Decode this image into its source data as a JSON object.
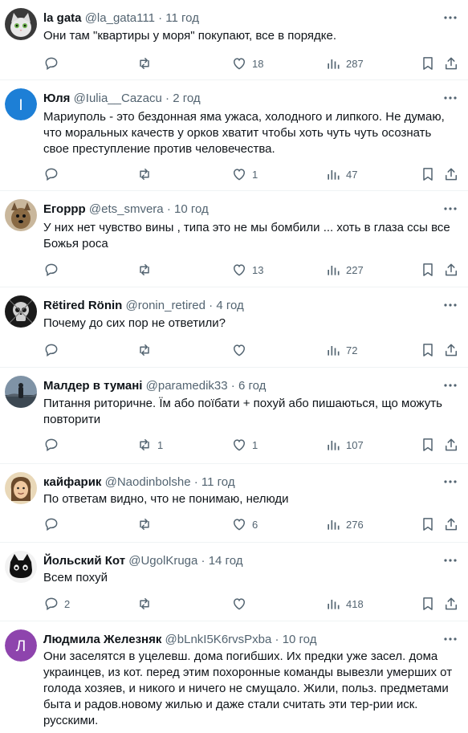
{
  "tweets": [
    {
      "name": "la gata",
      "handle": "@la_gata111",
      "time": "11 год",
      "text": "Они там \"квартиры у моря\" покупают, все в порядке.",
      "replies": "",
      "retweets": "",
      "likes": "18",
      "views": "287",
      "avatar": {
        "type": "cat",
        "bg": "#3a3a3a"
      }
    },
    {
      "name": "Юля",
      "handle": "@Iulia__Cazacu",
      "time": "2 год",
      "text": "Мариуполь - это бездонная яма ужаса, холодного и липкого. Не думаю, что моральных качеств у орков хватит чтобы хоть чуть чуть осознать свое преступление против человечества.",
      "replies": "",
      "retweets": "",
      "likes": "1",
      "views": "47",
      "avatar": {
        "type": "letter",
        "letter": "I",
        "bg": "#1d7fd6"
      }
    },
    {
      "name": "Егорpp",
      "handle": "@ets_smvera",
      "time": "10 год",
      "text": "У них нет чувство вины , типа это не мы бомбили ... хоть в глаза ссы все Божья роса",
      "replies": "",
      "retweets": "",
      "likes": "13",
      "views": "227",
      "avatar": {
        "type": "dog",
        "bg": "#c9b79c"
      }
    },
    {
      "name": "Rëtired Rönin",
      "handle": "@ronin_retired",
      "time": "4 год",
      "text": "Почему до сих пор не ответили?",
      "replies": "",
      "retweets": "",
      "likes": "",
      "views": "72",
      "avatar": {
        "type": "skull",
        "bg": "#1a1a1a"
      }
    },
    {
      "name": "Малдер в тумані",
      "handle": "@paramedik33",
      "time": "6 год",
      "text": "Питання риторичне. Їм або поїбати + похуй або пишаються, що можуть повторити",
      "replies": "",
      "retweets": "1",
      "likes": "1",
      "views": "107",
      "avatar": {
        "type": "landscape",
        "bg": "#5a6b7a"
      }
    },
    {
      "name": "кайфарик",
      "handle": "@Naodinbolshe",
      "time": "11 год",
      "text": "По ответам видно, что не понимаю, нелюди",
      "replies": "",
      "retweets": "",
      "likes": "6",
      "views": "276",
      "avatar": {
        "type": "face",
        "bg": "#e9d8b8"
      }
    },
    {
      "name": "Йольский Кот",
      "handle": "@UgolKruga",
      "time": "14 год",
      "text": "Всем похуй",
      "replies": "2",
      "retweets": "",
      "likes": "",
      "views": "418",
      "avatar": {
        "type": "blackcat",
        "bg": "#f2f2f2"
      }
    },
    {
      "name": "Людмила Железняк",
      "handle": "@bLnkI5K6rvsPxba",
      "time": "10 год",
      "text": "Они заселятся в уцелевш. дома погибших. Их предки уже засел. дома украинцев, из кот. перед этим похоронные команды вывезли умерших от голода хозяев, и никого и ничего не смущало. Жили, польз. предметами быта и радов.новому жилью и даже стали считать эти тер-рии иск. русскими.",
      "replies": "",
      "retweets": "",
      "likes": "",
      "views": "",
      "avatar": {
        "type": "letter",
        "letter": "Л",
        "bg": "#8e44ad"
      }
    }
  ],
  "colors": {
    "text": "#0f1419",
    "secondary": "#536471",
    "divider": "#eff3f4"
  },
  "icons": [
    "reply-icon",
    "retweet-icon",
    "like-icon",
    "views-icon",
    "bookmark-icon",
    "share-icon",
    "more-icon"
  ]
}
